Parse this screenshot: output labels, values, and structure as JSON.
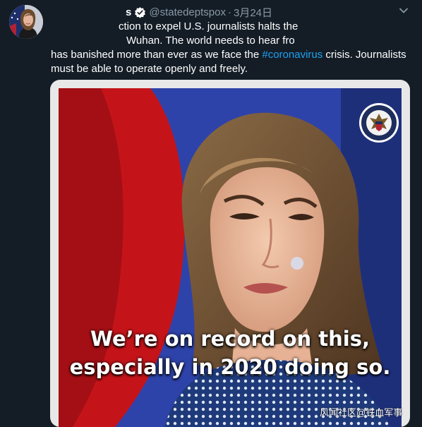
{
  "header": {
    "name_fragment": "s",
    "handle": "@statedeptspox",
    "separator": "·",
    "date": "3月24日"
  },
  "tweet": {
    "line1": "ction to expel U.S. journalists halts the",
    "line2": "Wuhan. The world needs to hear fro",
    "line3_before": "has banished more than ever as we face the ",
    "hashtag": "#coronavirus",
    "line3_after": " crisis. Journalists",
    "line4": "must be able to operate openly and freely."
  },
  "media": {
    "caption_line1": "We’re on record on this,",
    "caption_line2": "especially in 2020 doing so."
  },
  "watermark": "风闻社区@铁血军事",
  "colors": {
    "background": "#141d26",
    "link": "#1da1f2",
    "secondary_text": "#8899a6"
  },
  "icons": {
    "verified": "verified-badge-icon",
    "chevron": "chevron-down-icon",
    "seal": "department-seal-icon"
  }
}
